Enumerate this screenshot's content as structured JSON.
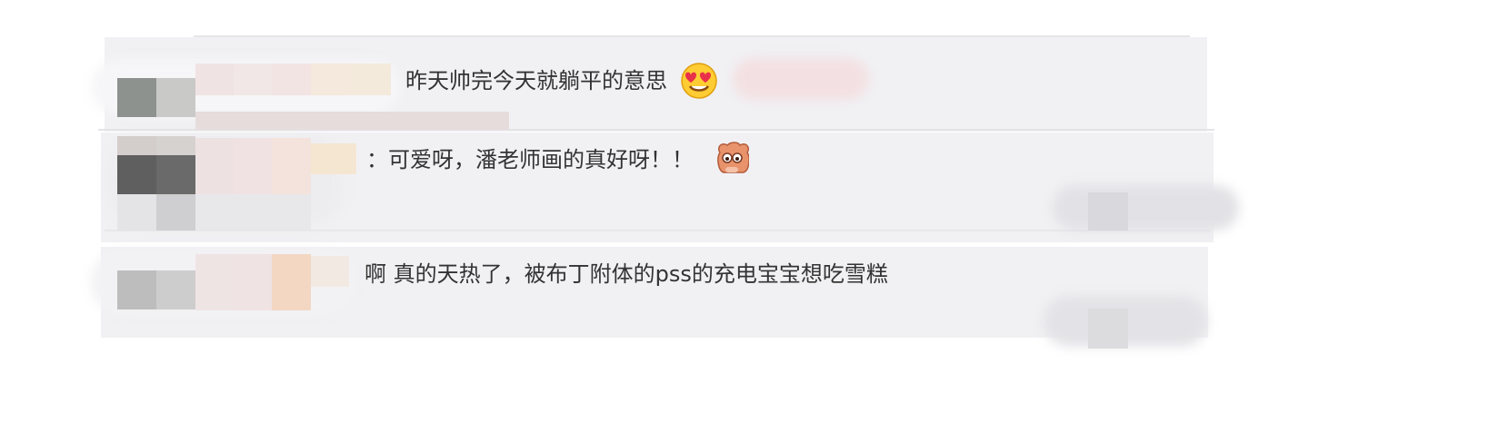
{
  "comments": [
    {
      "text": "昨天帅完今天就躺平的意思",
      "emoji": "heart-eyes-emoji"
    },
    {
      "text": "：可爱呀，潘老师画的真好呀！！",
      "emoji": "cute-bear-sticker"
    },
    {
      "text": "啊 真的天热了，被布丁附体的pss的充电宝宝想吃雪糕",
      "emoji": ""
    }
  ],
  "colors": {
    "panel_bg": "#f1f1f4",
    "text": "#333333",
    "mosaic_warm": "#f3d7c3",
    "mosaic_pink": "#f0e1e3",
    "avatar_dark": "#5f5f5f"
  }
}
